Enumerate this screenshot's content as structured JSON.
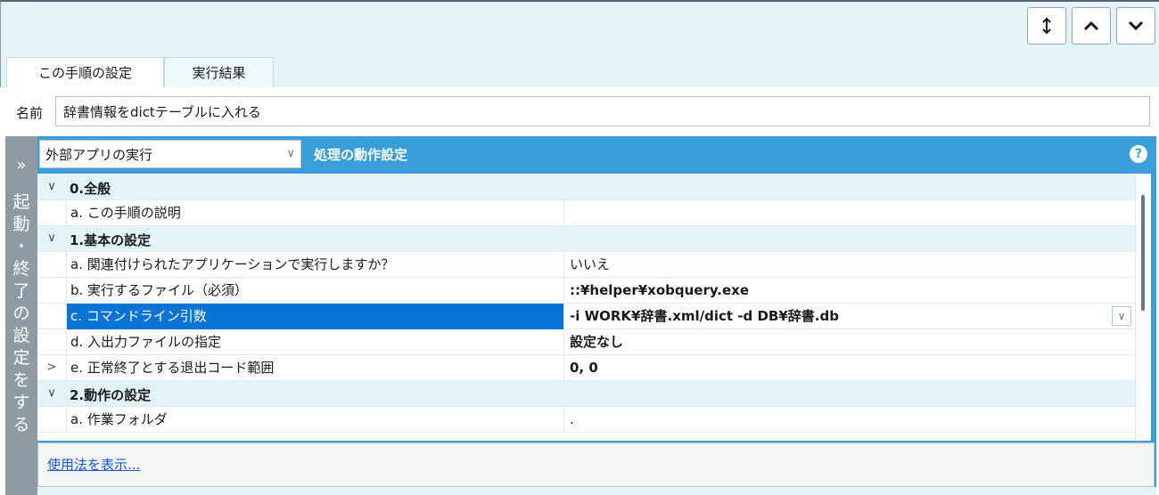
{
  "toolbar": {
    "icons": [
      "updown-arrow-icon",
      "chevron-up-icon",
      "chevron-down-icon"
    ]
  },
  "tabs": [
    {
      "label": "この手順の設定",
      "active": true
    },
    {
      "label": "実行結果",
      "active": false
    }
  ],
  "name": {
    "label": "名前",
    "value": "辞書情報をdictテーブルに入れる"
  },
  "sidebar": {
    "chevron": "»",
    "label": "起\n動\n・\n終\n了\nの\n設\n定\nを\nす\nる"
  },
  "panel": {
    "mode_select": "外部アプリの実行",
    "title": "処理の動作設定",
    "help": "?"
  },
  "grid": {
    "rows": [
      {
        "kind": "cat",
        "expander": "∨",
        "label": "0.全般"
      },
      {
        "kind": "prop",
        "label": "a. この手順の説明",
        "value": "",
        "bold": false
      },
      {
        "kind": "cat",
        "expander": "∨",
        "label": "1.基本の設定"
      },
      {
        "kind": "prop",
        "label": "a. 関連付けられたアプリケーションで実行しますか？",
        "value": "いいえ",
        "bold": false
      },
      {
        "kind": "prop",
        "label": "b. 実行するファイル（必須）",
        "value": "::¥helper¥xobquery.exe",
        "bold": true
      },
      {
        "kind": "prop",
        "label": "c. コマンドライン引数",
        "value": "-i WORK¥辞書.xml/dict -d DB¥辞書.db",
        "bold": true,
        "selected": true,
        "dropdown": true
      },
      {
        "kind": "prop",
        "label": "d. 入出力ファイルの指定",
        "value": "設定なし",
        "bold": true
      },
      {
        "kind": "prop",
        "expander": ">",
        "label": "e. 正常終了とする退出コード範囲",
        "value": "0, 0",
        "bold": true
      },
      {
        "kind": "cat",
        "expander": "∨",
        "label": "2.動作の設定"
      },
      {
        "kind": "prop",
        "label": "a. 作業フォルダ",
        "value": ".",
        "bold": false
      }
    ]
  },
  "footer": {
    "link": "使用法を表示..."
  },
  "colors": {
    "accent": "#3a9fd8",
    "selection": "#0a74d6",
    "band": "#e2f4f8",
    "sidebar": "#8e9ba3"
  }
}
